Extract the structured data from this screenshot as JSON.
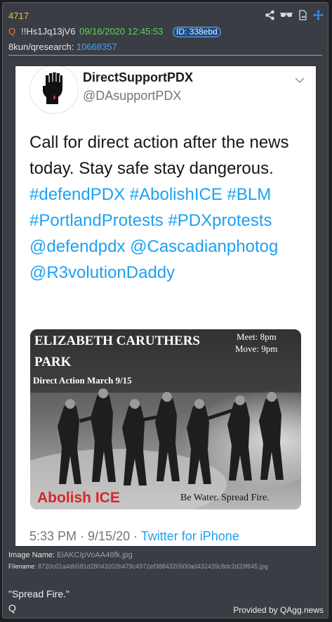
{
  "post": {
    "number": "4717",
    "author": "Q",
    "tripcode": "!!Hs1Jq13jV6",
    "datetime": "09/16/2020 12:45:53",
    "id_badge": "ID: 338ebd",
    "board": "8kun/qresearch:",
    "thread": "10668357"
  },
  "icons": [
    "share-icon",
    "glasses-icon",
    "image-file-icon",
    "move-icon"
  ],
  "tweet": {
    "display_name": "DirectSupportPDX",
    "handle": "@DAsupportPDX",
    "text_plain": "Call for direct action after the news today. Stay safe stay dangerous.",
    "text_tags": "#defendPDX #AbolishICE #BLM #PortlandProtests #PDXprotests @defendpdx @Cascadianphotog @R3volutionDaddy",
    "timestamp": "5:33 PM · 9/15/20 · ",
    "source": "Twitter for iPhone",
    "photo": {
      "line1": "ELIZABETH CARUTHERS",
      "line2": "PARK",
      "line3": "Direct Action March 9/15",
      "meet": "Meet: 8pm",
      "move": "Move: 9pm",
      "bottom_left": "Abolish ICE",
      "bottom_right": "Be Water. Spread Fire."
    }
  },
  "attachment": {
    "image_name_label": "Image Name:",
    "image_name": "EiAKCIpVoAA46fk.jpg",
    "filename_label": "Filename:",
    "filename": "8720c01a4db581d28043202b479c4972ef3884320500ad432439c8dc2d33f645.jpg"
  },
  "message": {
    "quote": "\"Spread Fire.\"",
    "signature": "Q"
  },
  "credit": "Provided by QAgg.news",
  "colors": {
    "background": "#1c1e22",
    "card": "#3a3d44",
    "post_number": "#f3c03a",
    "date": "#5fd35f",
    "link": "#4aa3f0",
    "twitter_blue": "#1da1f2",
    "red_text": "#d8262a"
  }
}
